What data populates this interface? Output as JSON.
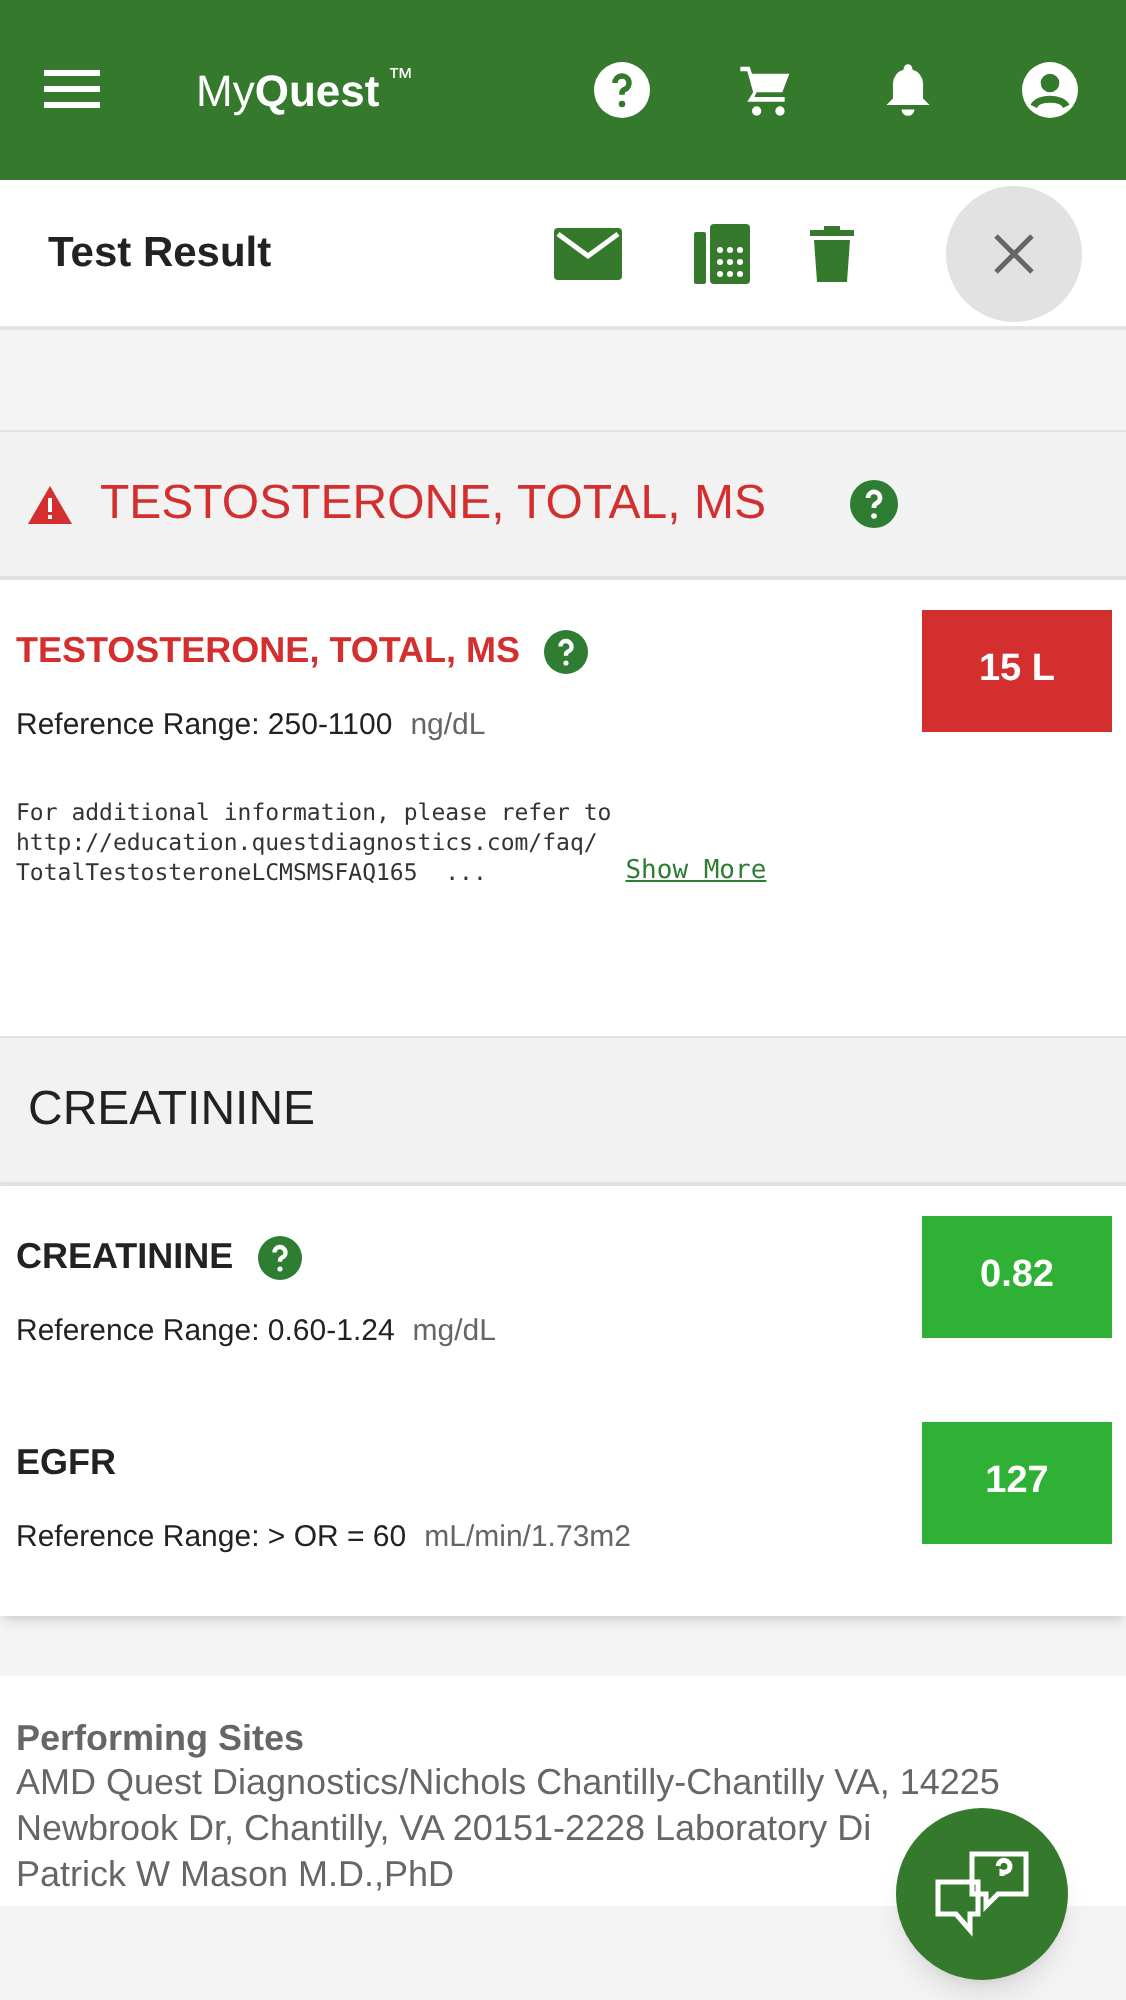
{
  "app_bar": {
    "brand_light": "My",
    "brand_bold": "Quest",
    "trademark": "™"
  },
  "toolbar": {
    "title": "Test Result"
  },
  "sections": [
    {
      "title": "TESTOSTERONE, TOTAL, MS",
      "flagged": true,
      "help": true,
      "results": [
        {
          "name": "TESTOSTERONE, TOTAL, MS",
          "flagged": true,
          "help": true,
          "range": "Reference Range: 250-1100",
          "unit": "ng/dL",
          "value": "15 L",
          "color": "#d32f2f",
          "note": "For additional information, please refer to\nhttp://education.questdiagnostics.com/faq/\nTotalTestosteroneLCMSMSFAQ165  ...",
          "more": "Show More"
        }
      ]
    },
    {
      "title": "CREATININE",
      "flagged": false,
      "help": false,
      "results": [
        {
          "name": "CREATININE",
          "flagged": false,
          "help": true,
          "range": "Reference Range: 0.60-1.24",
          "unit": "mg/dL",
          "value": "0.82",
          "color": "#2eb135"
        },
        {
          "name": "EGFR",
          "flagged": false,
          "help": false,
          "range": "Reference Range: > OR = 60",
          "unit": "mL/min/1.73m2",
          "value": "127",
          "color": "#2eb135"
        }
      ]
    }
  ],
  "performing_sites": {
    "title": "Performing Sites",
    "lines": [
      "AMD Quest Diagnostics/Nichols Chantilly-Chantilly VA, 14225",
      "Newbrook Dr, Chantilly, VA 20151-2228 Laboratory Di",
      "Patrick W Mason M.D.,PhD"
    ]
  }
}
